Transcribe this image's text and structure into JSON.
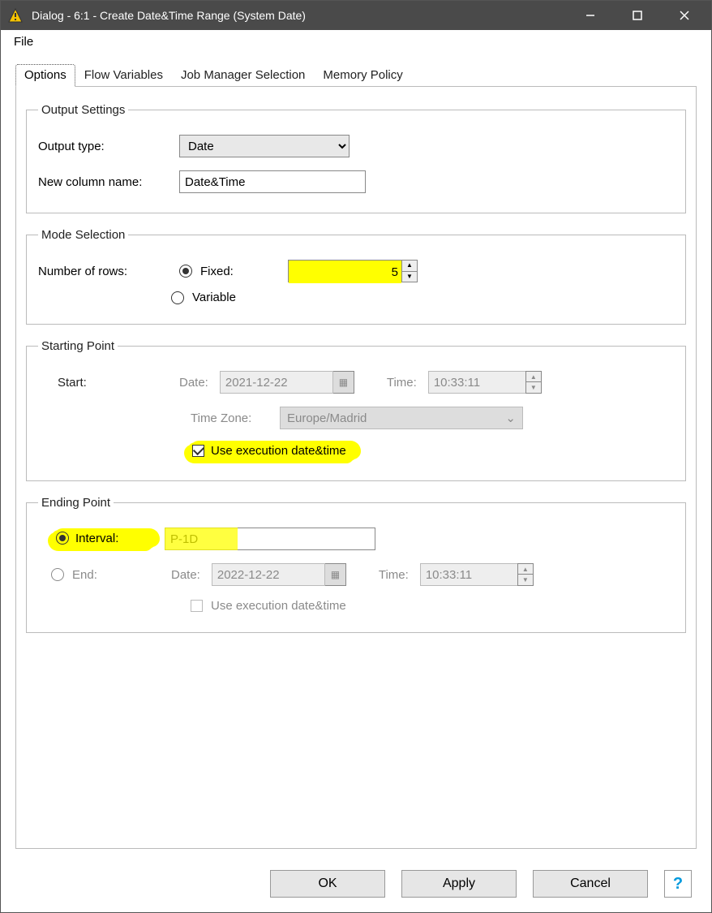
{
  "window": {
    "title": "Dialog - 6:1 - Create Date&Time Range (System Date)"
  },
  "menubar": {
    "file": "File"
  },
  "tabs": {
    "options": "Options",
    "flow_vars": "Flow Variables",
    "job_mgr": "Job Manager Selection",
    "memory": "Memory Policy"
  },
  "output_settings": {
    "legend": "Output Settings",
    "output_type_label": "Output type:",
    "output_type_value": "Date",
    "new_col_label": "New column name:",
    "new_col_value": "Date&Time"
  },
  "mode_selection": {
    "legend": "Mode Selection",
    "rows_label": "Number of rows:",
    "fixed_label": "Fixed:",
    "fixed_value": "5",
    "variable_label": "Variable"
  },
  "starting_point": {
    "legend": "Starting Point",
    "start_label": "Start:",
    "date_label": "Date:",
    "date_value": "2021-12-22",
    "time_label": "Time:",
    "time_value": "10:33:11",
    "tz_label": "Time Zone:",
    "tz_value": "Europe/Madrid",
    "use_exec_label": "Use execution date&time"
  },
  "ending_point": {
    "legend": "Ending Point",
    "interval_label": "Interval:",
    "interval_value": "P-1D",
    "end_label": "End:",
    "date_label": "Date:",
    "date_value": "2022-12-22",
    "time_label": "Time:",
    "time_value": "10:33:11",
    "use_exec_label": "Use execution date&time"
  },
  "buttons": {
    "ok": "OK",
    "apply": "Apply",
    "cancel": "Cancel"
  }
}
